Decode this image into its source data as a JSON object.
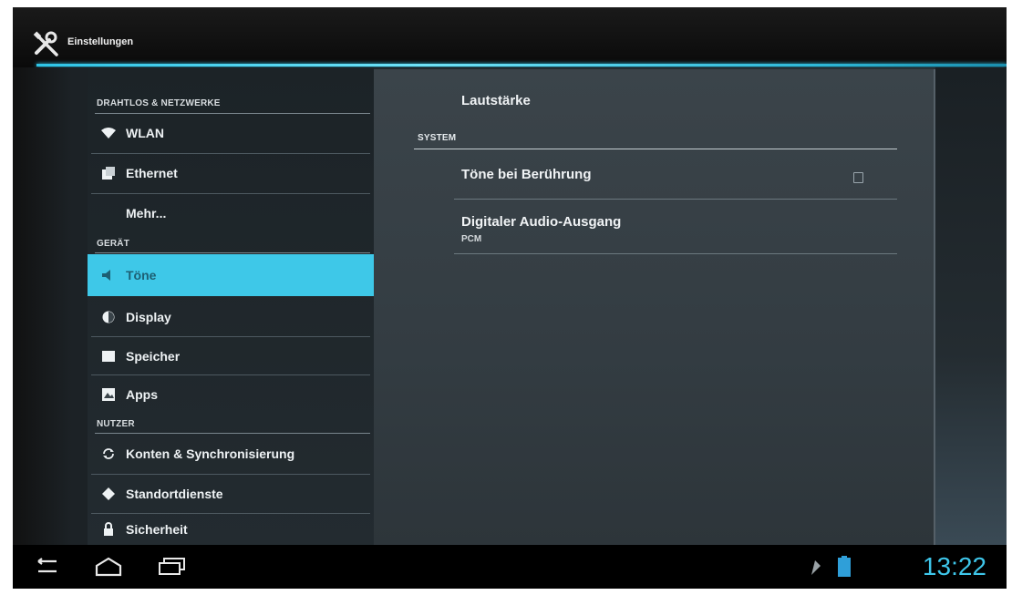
{
  "action_bar": {
    "title": "Einstellungen",
    "icon": "wrench-screwdriver-icon"
  },
  "sidebar": {
    "sections": [
      {
        "header": "DRAHTLOS & NETZWERKE"
      },
      {
        "header": "GERÄT"
      },
      {
        "header": "NUTZER"
      }
    ],
    "items": [
      {
        "label": "WLAN",
        "icon": "wifi-icon"
      },
      {
        "label": "Ethernet",
        "icon": "ethernet-icon"
      },
      {
        "label": "Mehr...",
        "icon": ""
      },
      {
        "label": "Töne",
        "icon": "speaker-icon",
        "selected": true
      },
      {
        "label": "Display",
        "icon": "display-icon"
      },
      {
        "label": "Speicher",
        "icon": "storage-icon"
      },
      {
        "label": "Apps",
        "icon": "apps-icon"
      },
      {
        "label": "Konten & Synchronisierung",
        "icon": "sync-icon"
      },
      {
        "label": "Standortdienste",
        "icon": "location-icon"
      },
      {
        "label": "Sicherheit",
        "icon": "lock-icon"
      }
    ]
  },
  "detail": {
    "volume_label": "Lautstärke",
    "system_header": "SYSTEM",
    "touch_sounds_label": "Töne bei Berührung",
    "touch_sounds_checked": false,
    "digital_audio_label": "Digitaler Audio-Ausgang",
    "digital_audio_value": "PCM"
  },
  "navbar": {
    "back": "back-icon",
    "home": "home-icon",
    "recents": "recents-icon",
    "time": "13:22",
    "accent": "#3ec6ea"
  }
}
